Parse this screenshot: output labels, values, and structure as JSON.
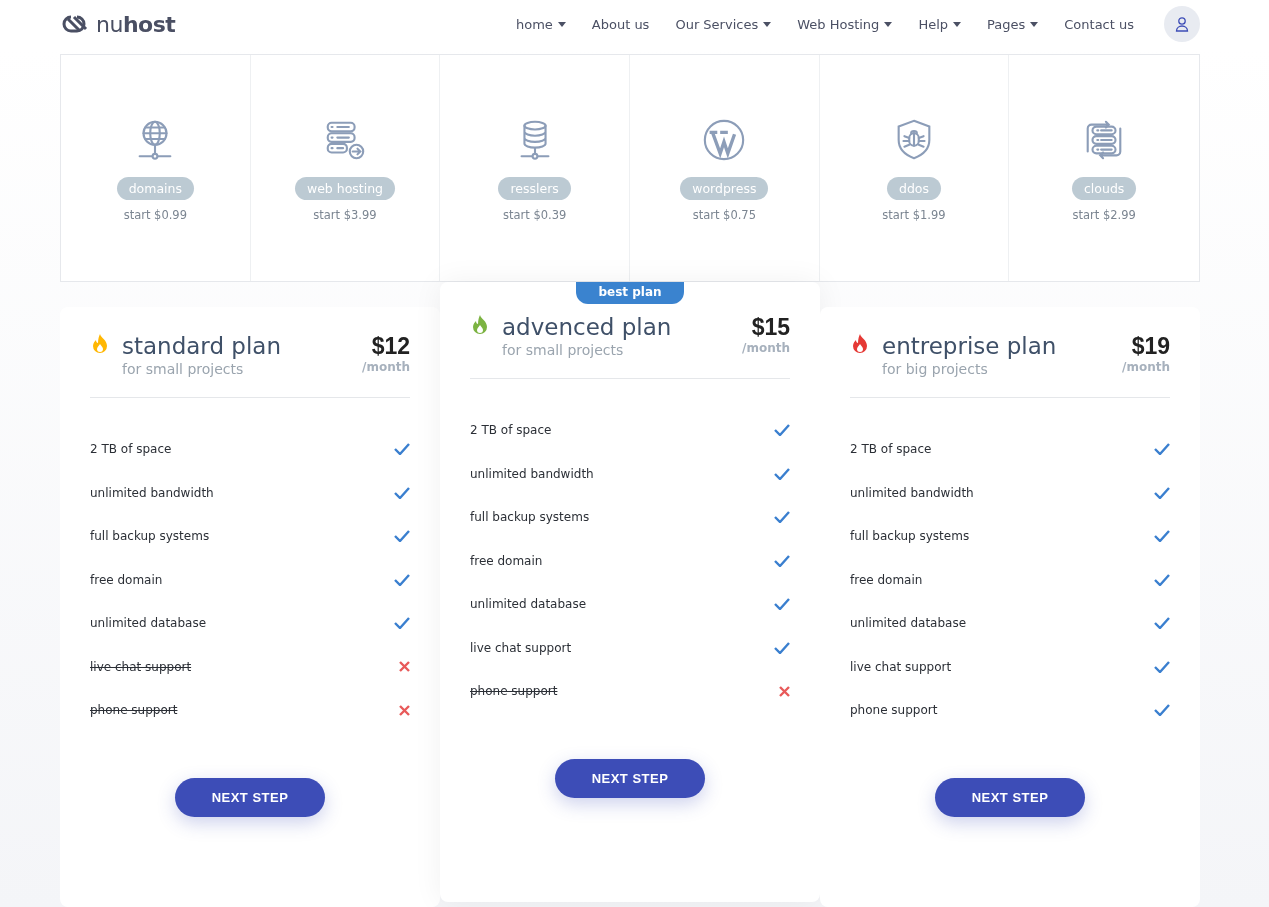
{
  "brand": {
    "light": "nu",
    "bold": "host"
  },
  "nav": [
    {
      "label": "home",
      "dropdown": true
    },
    {
      "label": "About us",
      "dropdown": false
    },
    {
      "label": "Our Services",
      "dropdown": true
    },
    {
      "label": "Web Hosting",
      "dropdown": true
    },
    {
      "label": "Help",
      "dropdown": true
    },
    {
      "label": "Pages",
      "dropdown": true
    },
    {
      "label": "Contact us",
      "dropdown": false
    }
  ],
  "services": [
    {
      "kind": "globe",
      "name": "domains",
      "price": "start $0.99"
    },
    {
      "kind": "server",
      "name": "web hosting",
      "price": "start $3.99"
    },
    {
      "kind": "database",
      "name": "resslers",
      "price": "start $0.39"
    },
    {
      "kind": "wordpress",
      "name": "wordpress",
      "price": "start $0.75"
    },
    {
      "kind": "shield",
      "name": "ddos",
      "price": "start $1.99"
    },
    {
      "kind": "cloud",
      "name": "clouds",
      "price": "start $2.99"
    }
  ],
  "plans": [
    {
      "name": "standard plan",
      "subtitle": "for small projects",
      "price": "$12",
      "period": "/month",
      "color": "#ffb703",
      "featured": false,
      "button": "NEXT STEP",
      "features": [
        {
          "label": "2 TB of space",
          "included": true
        },
        {
          "label": "unlimited bandwidth",
          "included": true
        },
        {
          "label": "full backup systems",
          "included": true
        },
        {
          "label": "free domain",
          "included": true
        },
        {
          "label": "unlimited database",
          "included": true
        },
        {
          "label": "live chat support",
          "included": false
        },
        {
          "label": "phone support",
          "included": false
        }
      ]
    },
    {
      "name": "advenced plan",
      "subtitle": "for small projects",
      "price": "$15",
      "period": "/month",
      "color": "#7cb342",
      "featured": true,
      "badge": "best plan",
      "button": "NEXT STEP",
      "features": [
        {
          "label": "2 TB of space",
          "included": true
        },
        {
          "label": "unlimited bandwidth",
          "included": true
        },
        {
          "label": "full backup systems",
          "included": true
        },
        {
          "label": "free domain",
          "included": true
        },
        {
          "label": "unlimited database",
          "included": true
        },
        {
          "label": "live chat support",
          "included": true
        },
        {
          "label": "phone support",
          "included": false
        }
      ]
    },
    {
      "name": "entreprise plan",
      "subtitle": "for big projects",
      "price": "$19",
      "period": "/month",
      "color": "#e53935",
      "featured": false,
      "button": "NEXT STEP",
      "features": [
        {
          "label": "2 TB of space",
          "included": true
        },
        {
          "label": "unlimited bandwidth",
          "included": true
        },
        {
          "label": "full backup systems",
          "included": true
        },
        {
          "label": "free domain",
          "included": true
        },
        {
          "label": "unlimited database",
          "included": true
        },
        {
          "label": "live chat support",
          "included": true
        },
        {
          "label": "phone support",
          "included": true
        }
      ]
    }
  ]
}
